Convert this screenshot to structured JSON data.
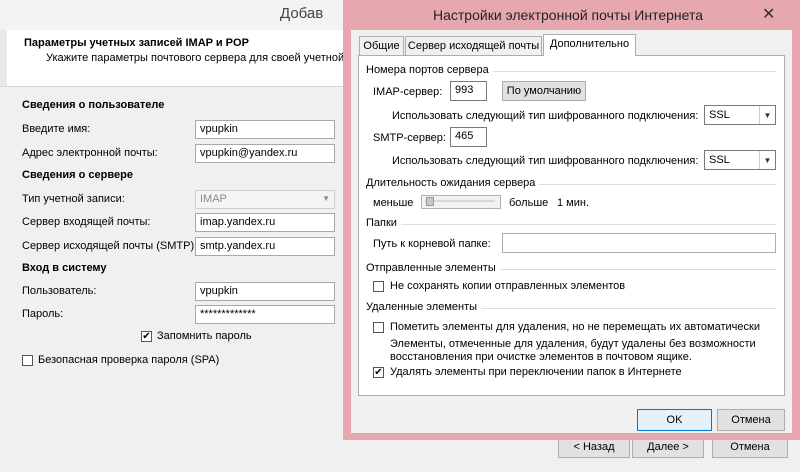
{
  "wizard": {
    "title": "Добав",
    "header_title": "Параметры учетных записей IMAP и POP",
    "header_subtitle": "Укажите параметры почтового сервера для своей учетной за",
    "user_section": "Сведения о пользователе",
    "name_label": "Введите имя:",
    "name_value": "vpupkin",
    "email_label": "Адрес электронной почты:",
    "email_value": "vpupkin@yandex.ru",
    "server_section": "Сведения о сервере",
    "account_type_label": "Тип учетной записи:",
    "account_type_value": "IMAP",
    "incoming_label": "Сервер входящей почты:",
    "incoming_value": "imap.yandex.ru",
    "outgoing_label": "Сервер исходящей почты (SMTP):",
    "outgoing_value": "smtp.yandex.ru",
    "login_section": "Вход в систему",
    "user_label": "Пользователь:",
    "user_value": "vpupkin",
    "password_label": "Пароль:",
    "password_value": "*************",
    "remember_password": "Запомнить пароль",
    "spa_label": "Безопасная проверка пароля (SPA)",
    "back_button": "< Назад",
    "next_button": "Далее >",
    "cancel_button": "Отмена"
  },
  "dialog": {
    "title": "Настройки электронной почты Интернета",
    "close_glyph": "✕",
    "tabs": [
      {
        "label": "Общие",
        "active": false
      },
      {
        "label": "Сервер исходящей почты",
        "active": false
      },
      {
        "label": "Дополнительно",
        "active": true
      }
    ],
    "ports_group": "Номера портов сервера",
    "imap_label": "IMAP-сервер:",
    "imap_port": "993",
    "default_button": "По умолчанию",
    "encryption_label": "Использовать следующий тип шифрованного подключения:",
    "imap_encryption": "SSL",
    "smtp_label": "SMTP-сервер:",
    "smtp_port": "465",
    "smtp_encryption_label": "Использовать следующий тип шифрованного подключения:",
    "smtp_encryption": "SSL",
    "timeout_group": "Длительность ожидания сервера",
    "timeout_less": "меньше",
    "timeout_more": "больше",
    "timeout_value": "1 мин.",
    "folders_group": "Папки",
    "root_folder_label": "Путь к корневой папке:",
    "root_folder_value": "",
    "sent_group": "Отправленные элементы",
    "dont_save_sent": "Не сохранять копии отправленных элементов",
    "deleted_group": "Удаленные элементы",
    "mark_for_deletion": "Пометить элементы для удаления, но не перемещать их автоматически",
    "deletion_note_1": "Элементы, отмеченные для удаления, будут удалены без возможности",
    "deletion_note_2": "восстановления при очистке элементов в почтовом ящике.",
    "purge_on_switch": "Удалять элементы при переключении папок в Интернете",
    "ok_button": "OK",
    "cancel_button": "Отмена",
    "checks": {
      "dont_save_sent": false,
      "mark_for_deletion": false,
      "purge_on_switch": true
    }
  },
  "colors": {
    "dialog_frame": "#e7a7ae",
    "accent_border": "#0078d7"
  }
}
